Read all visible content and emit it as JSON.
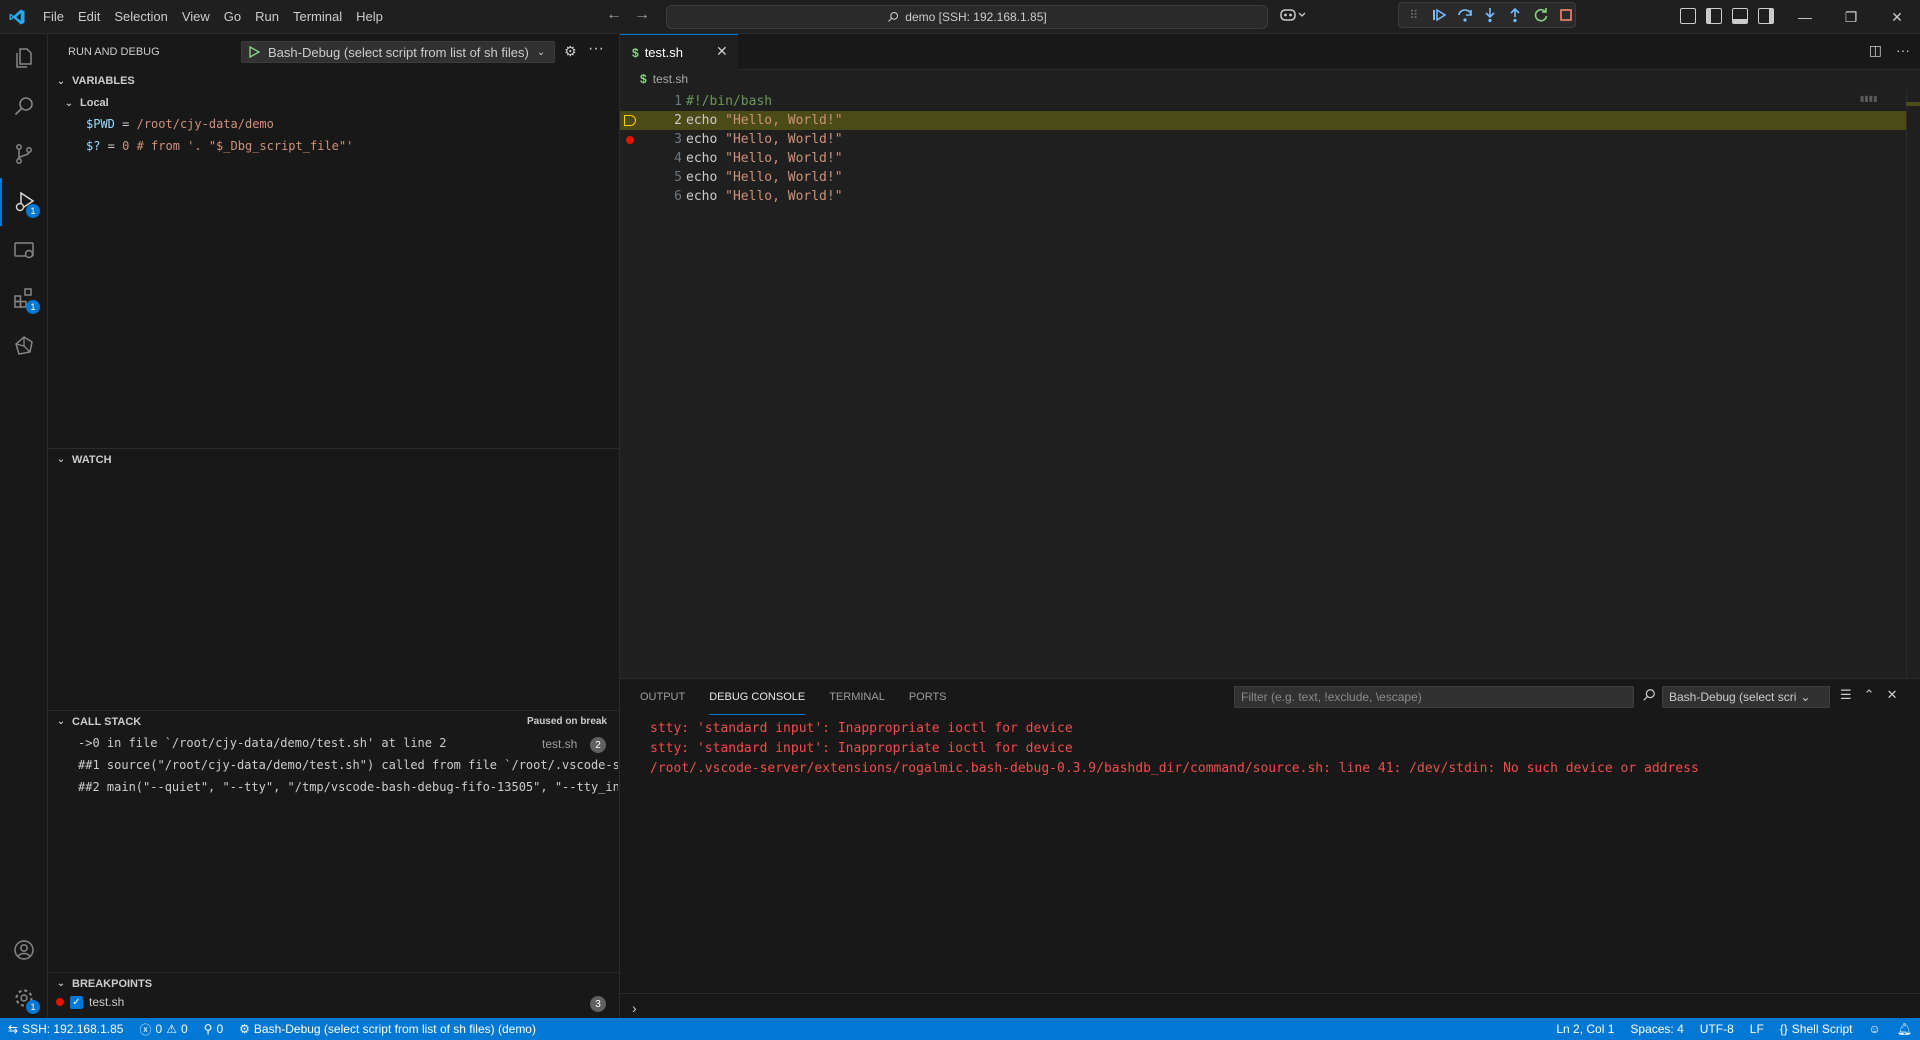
{
  "titlebar": {
    "menu": [
      "File",
      "Edit",
      "Selection",
      "View",
      "Go",
      "Run",
      "Terminal",
      "Help"
    ],
    "command_center": "demo [SSH: 192.168.1.85]"
  },
  "sidebar": {
    "title": "RUN AND DEBUG",
    "launch_config": "Bash-Debug (select script from list of sh files)",
    "variables": {
      "header": "VARIABLES",
      "scope": "Local",
      "items": [
        {
          "name": "$PWD",
          "eq": " = ",
          "value": "/root/cjy-data/demo"
        },
        {
          "name": "$?",
          "eq": "  = ",
          "value": "0 # from '. \"$_Dbg_script_file\"'"
        }
      ]
    },
    "watch": {
      "header": "WATCH"
    },
    "call_stack": {
      "header": "CALL STACK",
      "status": "Paused on break",
      "frames": [
        {
          "text": "->0 in file `/root/cjy-data/demo/test.sh' at line 2",
          "file": "test.sh",
          "count": "2"
        },
        {
          "text": "##1 source(\"/root/cjy-data/demo/test.sh\") called from file `/root/.vscode-se",
          "file": "",
          "count": ""
        },
        {
          "text": "##2 main(\"--quiet\", \"--tty\", \"/tmp/vscode-bash-debug-fifo-13505\", \"--tty_in\"",
          "file": "",
          "count": ""
        }
      ]
    },
    "breakpoints": {
      "header": "BREAKPOINTS",
      "items": [
        {
          "file": "test.sh",
          "count": "3"
        }
      ]
    }
  },
  "editor": {
    "tab_label": "test.sh",
    "breadcrumb": "test.sh",
    "lines": [
      {
        "num": "1",
        "parts": [
          {
            "t": "#!/bin/bash",
            "c": "comment"
          }
        ]
      },
      {
        "num": "2",
        "parts": [
          {
            "t": "echo",
            "c": "plain"
          },
          {
            "t": " ",
            "c": "plain"
          },
          {
            "t": "\"Hello, World!\"",
            "c": "str"
          }
        ]
      },
      {
        "num": "3",
        "parts": [
          {
            "t": "echo",
            "c": "plain"
          },
          {
            "t": " ",
            "c": "plain"
          },
          {
            "t": "\"Hello, World!\"",
            "c": "str"
          }
        ]
      },
      {
        "num": "4",
        "parts": [
          {
            "t": "echo",
            "c": "plain"
          },
          {
            "t": " ",
            "c": "plain"
          },
          {
            "t": "\"Hello, World!\"",
            "c": "str"
          }
        ]
      },
      {
        "num": "5",
        "parts": [
          {
            "t": "echo",
            "c": "plain"
          },
          {
            "t": " ",
            "c": "plain"
          },
          {
            "t": "\"Hello, World!\"",
            "c": "str"
          }
        ]
      },
      {
        "num": "6",
        "parts": [
          {
            "t": "echo",
            "c": "plain"
          },
          {
            "t": " ",
            "c": "plain"
          },
          {
            "t": "\"Hello, World!\"",
            "c": "str"
          }
        ]
      }
    ],
    "current_line": "2",
    "breakpoint_line": "3"
  },
  "panel": {
    "tabs": [
      "OUTPUT",
      "DEBUG CONSOLE",
      "TERMINAL",
      "PORTS"
    ],
    "active_tab": "DEBUG CONSOLE",
    "filter_placeholder": "Filter (e.g. text, !exclude, \\escape)",
    "session": "Bash-Debug (select scri",
    "console_lines": [
      "stty: 'standard input': Inappropriate ioctl for device",
      "stty: 'standard input': Inappropriate ioctl for device",
      "/root/.vscode-server/extensions/rogalmic.bash-debug-0.3.9/bashdb_dir/command/source.sh: line 41: /dev/stdin: No such device or address"
    ]
  },
  "statusbar": {
    "remote": "SSH: 192.168.1.85",
    "errors": "0",
    "warnings": "0",
    "ports": "0",
    "debug_session": "Bash-Debug (select script from list of sh files) (demo)",
    "position": "Ln 2, Col 1",
    "spaces": "Spaces: 4",
    "encoding": "UTF-8",
    "eol": "LF",
    "language": "Shell Script"
  },
  "colors": {
    "accent": "#0078d4",
    "current_line": "#4b4b18",
    "error_text": "#f14c4c",
    "breakpoint": "#e51400",
    "debug_arrow": "#ffcc00"
  },
  "icons": [
    "explorer-icon",
    "search-icon",
    "source-control-icon",
    "run-debug-icon",
    "remote-explorer-icon",
    "extensions-icon",
    "deploy-icon",
    "account-icon",
    "manage-gear-icon"
  ],
  "activity_badges": {
    "run_debug": "1",
    "extensions": "1",
    "manage": "1"
  }
}
